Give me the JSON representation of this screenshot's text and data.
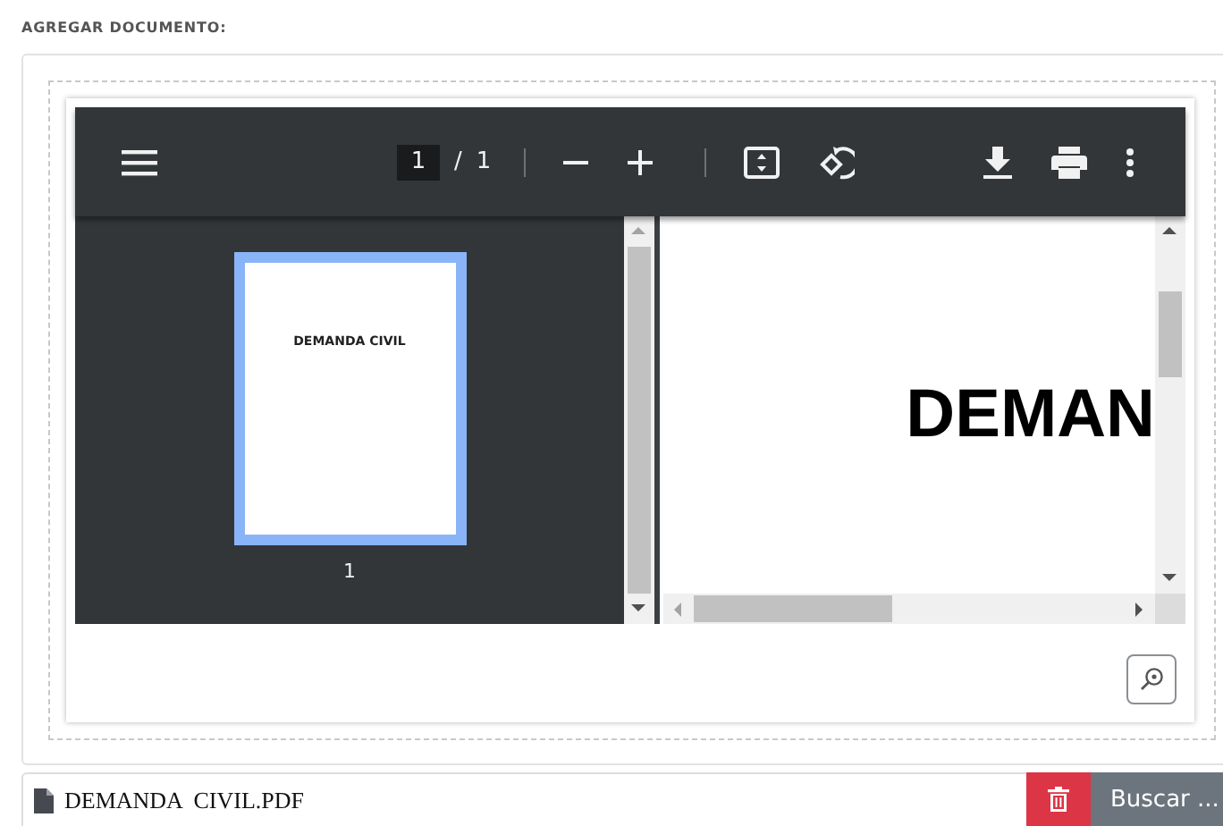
{
  "section_label": "AGREGAR DOCUMENTO:",
  "viewer": {
    "toolbar": {
      "page_input": "1",
      "page_separator": "/",
      "page_total": "1"
    },
    "thumbnails": [
      {
        "title": "DEMANDA CIVIL",
        "page_number": "1",
        "selected": true
      }
    ],
    "page": {
      "title": "DEMAN"
    }
  },
  "file": {
    "name": "DEMANDA  CIVIL.PDF",
    "browse_button": "Buscar ..."
  }
}
